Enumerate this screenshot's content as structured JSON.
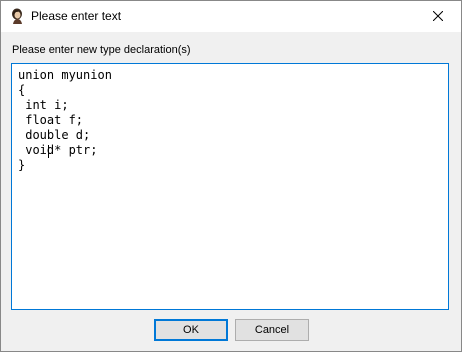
{
  "window": {
    "title": "Please enter text",
    "app_icon": "portrait-icon",
    "close_icon": "close-icon"
  },
  "form": {
    "prompt": "Please enter new type declaration(s)",
    "editor_value": "union myunion\n{\n int i;\n float f;\n double d;\n void* ptr;\n}",
    "caret_line": 6,
    "caret_column": 2
  },
  "buttons": {
    "ok_label": "OK",
    "cancel_label": "Cancel"
  },
  "colors": {
    "focus_border": "#0078d7",
    "dialog_background": "#f0f0f0",
    "button_face": "#e1e1e1"
  }
}
